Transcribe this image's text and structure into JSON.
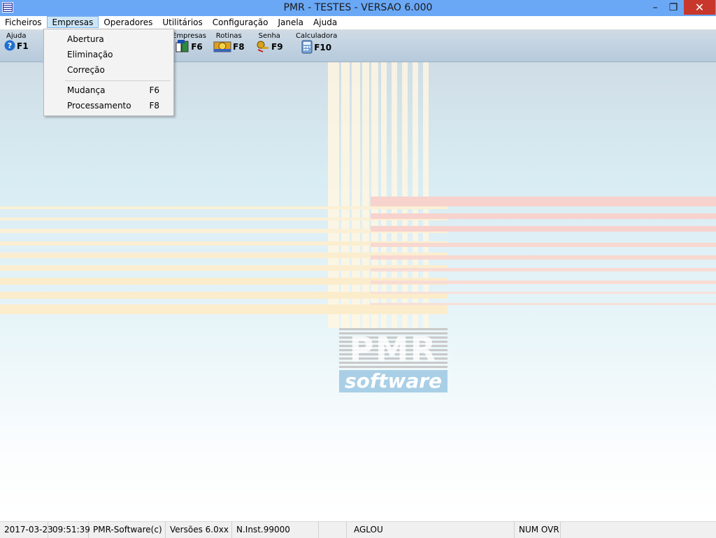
{
  "window": {
    "title": "PMR - TESTES - VERSAO 6.000",
    "minimize_glyph": "–",
    "restore_glyph": "❐",
    "close_glyph": "✕"
  },
  "menubar": {
    "items": [
      {
        "label": "Ficheiros"
      },
      {
        "label": "Empresas",
        "active": true
      },
      {
        "label": "Operadores"
      },
      {
        "label": "Utilitários"
      },
      {
        "label": "Configuração"
      },
      {
        "label": "Janela"
      },
      {
        "label": "Ajuda"
      }
    ]
  },
  "toolbar": {
    "ajuda": {
      "label": "Ajuda",
      "key": "F1",
      "icon": "help-icon"
    },
    "empresas": {
      "label": "Empresas",
      "key": "F6",
      "icon": "companies-icon"
    },
    "rotinas": {
      "label": "Rotinas",
      "key": "F8",
      "icon": "routines-icon"
    },
    "senha": {
      "label": "Senha",
      "key": "F9",
      "icon": "password-icon"
    },
    "calculadora": {
      "label": "Calculadora",
      "key": "F10",
      "icon": "calculator-icon"
    }
  },
  "dropdown": {
    "items": [
      {
        "label": "Abertura",
        "shortcut": ""
      },
      {
        "label": "Eliminação",
        "shortcut": ""
      },
      {
        "label": "Correção",
        "shortcut": ""
      },
      {
        "label": "Mudança",
        "shortcut": "F6"
      },
      {
        "label": "Processamento",
        "shortcut": "F8"
      }
    ]
  },
  "logo": {
    "text_top": "PMR",
    "text_bottom": "software"
  },
  "statusbar": {
    "date": "2017-03-23",
    "time": "09:51:39",
    "copyright": "PMR-Software(c)",
    "versions": "Versões 6.0xx",
    "installation": "N.Inst.99000",
    "blank": "",
    "user": "AGLOU",
    "keys": "NUM OVR"
  },
  "colors": {
    "titlebar": "#6aa8f6",
    "close_button": "#c7372b",
    "menu_active": "#cde6f7"
  }
}
